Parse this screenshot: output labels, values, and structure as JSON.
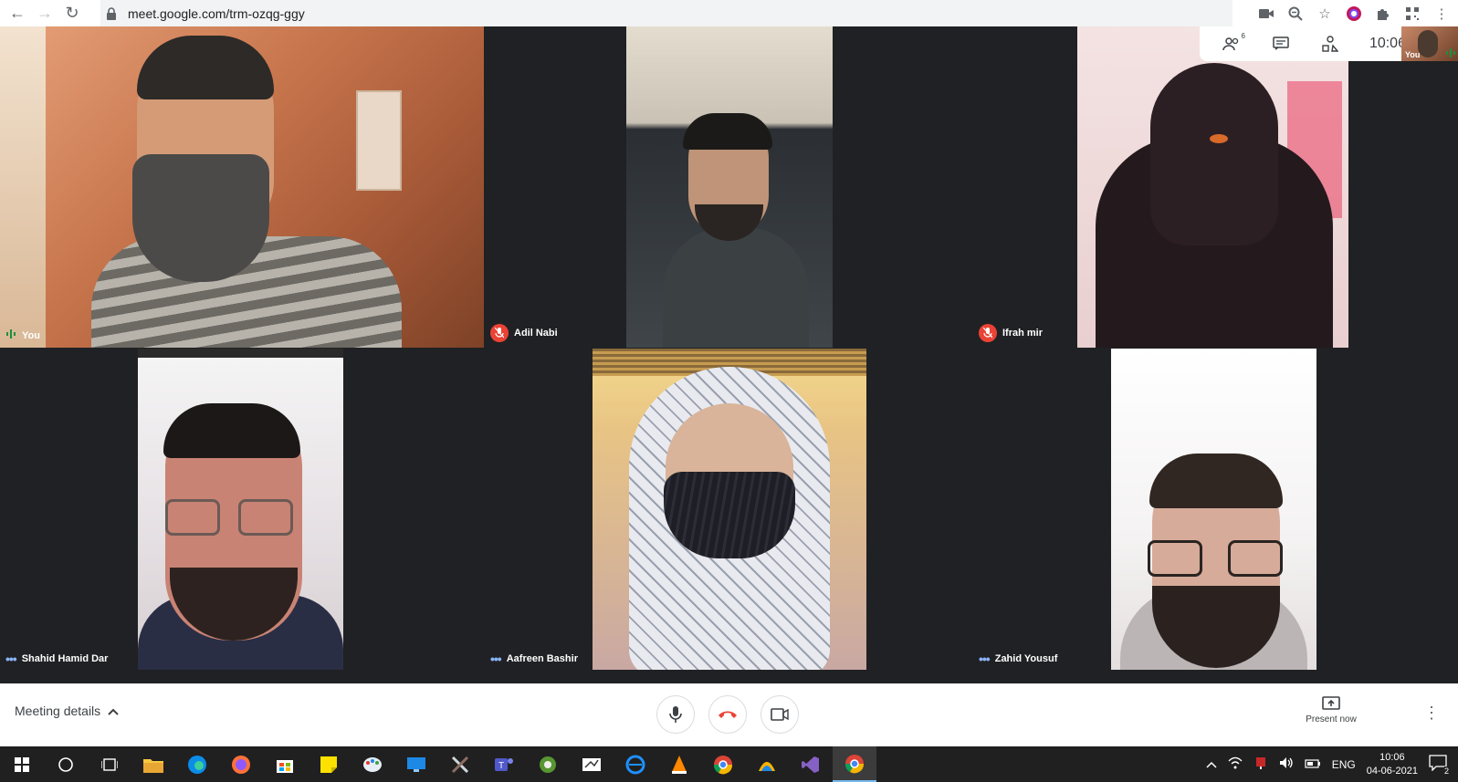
{
  "browser": {
    "url": "meet.google.com/trm-ozqg-ggy"
  },
  "top_panel": {
    "participants_count": "6",
    "clock": "10:06",
    "self_label": "You"
  },
  "tiles": [
    {
      "name": "You",
      "status": "speaking"
    },
    {
      "name": "Adil Nabi",
      "status": "muted"
    },
    {
      "name": "Ifrah mir",
      "status": "muted"
    },
    {
      "name": "Shahid Hamid Dar",
      "status": "more"
    },
    {
      "name": "Aafreen Bashir",
      "status": "more"
    },
    {
      "name": "Zahid Yousuf",
      "status": "more"
    }
  ],
  "controls": {
    "meeting_details": "Meeting details",
    "present_now": "Present now"
  },
  "taskbar": {
    "language": "ENG",
    "time": "10:06",
    "date": "04-06-2021",
    "notifications": "2"
  },
  "colors": {
    "stage_bg": "#202124",
    "mute_red": "#ea4335",
    "speaking_green": "#1e8e3e",
    "dots_blue": "#8ab4f8"
  }
}
